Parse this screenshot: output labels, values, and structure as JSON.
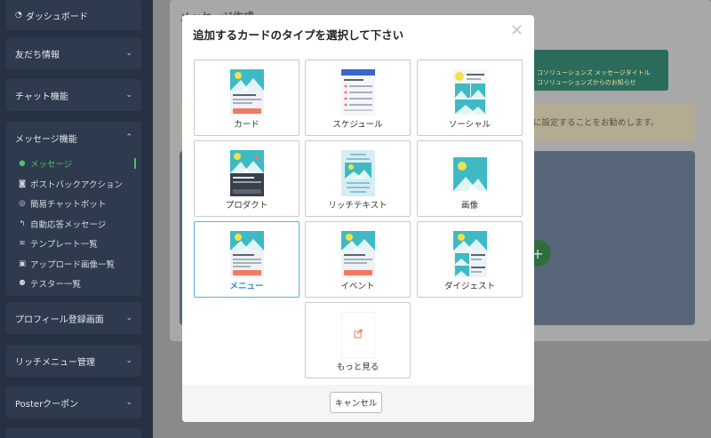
{
  "sidebar": {
    "dashboard": "ダッシュボード",
    "groups": [
      {
        "label": "友だち情報"
      },
      {
        "label": "チャット機能"
      }
    ],
    "message_section": {
      "label": "メッセージ機能",
      "items": [
        {
          "label": "メッセージ",
          "icon": "chat-bubble-icon"
        },
        {
          "label": "ポストバックアクション",
          "icon": "robot-icon"
        },
        {
          "label": "簡易チャットボット",
          "icon": "headset-icon"
        },
        {
          "label": "自動応答メッセージ",
          "icon": "reply-icon"
        },
        {
          "label": "テンプレート一覧",
          "icon": "layers-icon"
        },
        {
          "label": "アップロード画像一覧",
          "icon": "images-icon"
        },
        {
          "label": "テスター一覧",
          "icon": "users-icon"
        }
      ]
    },
    "groups_bottom": [
      {
        "label": "プロフィール登録画面"
      },
      {
        "label": "リッチメニュー管理"
      },
      {
        "label": "Posterクーポン"
      }
    ]
  },
  "background": {
    "page_title": "メッセージ作成",
    "banner_line1": "コソリューションズ        メッセージタイトル",
    "banner_line2": "コソリューションズからのお知らせ",
    "note": "に設定することをお勧めします。"
  },
  "modal": {
    "title": "追加するカードのタイプを選択して下さい",
    "close": "×",
    "cancel_label": "キャンセル",
    "card_types": [
      {
        "label": "カード"
      },
      {
        "label": "スケジュール"
      },
      {
        "label": "ソーシャル"
      },
      {
        "label": "プロダクト"
      },
      {
        "label": "リッチテキスト"
      },
      {
        "label": "画像"
      },
      {
        "label": "メニュー",
        "selected": true
      },
      {
        "label": "イベント"
      },
      {
        "label": "ダイジェスト"
      },
      {
        "label": "もっと見る"
      }
    ]
  },
  "colors": {
    "sidebar_bg": "#263143",
    "accent_green": "#4fbf66",
    "selected_blue": "#2a8fd0",
    "image_teal": "#3fbac4",
    "image_yellow": "#f2e04a",
    "button_red": "#f07a62"
  }
}
